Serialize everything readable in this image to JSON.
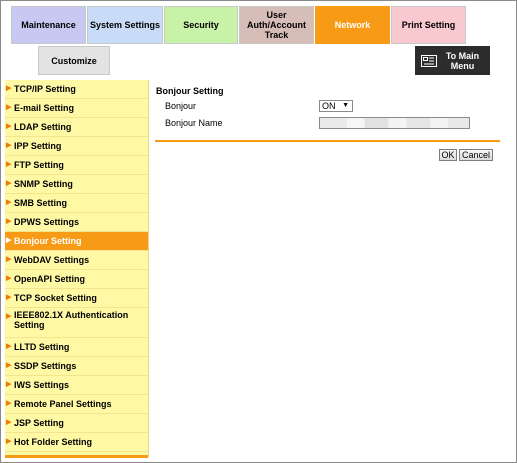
{
  "tabs": {
    "maintenance": "Maintenance",
    "system_settings": "System Settings",
    "security": "Security",
    "user_auth_line1": "User",
    "user_auth_line2": "Auth/Account",
    "user_auth_line3": "Track",
    "network": "Network",
    "print_setting": "Print Setting",
    "customize": "Customize"
  },
  "main_menu": {
    "line1": "To Main",
    "line2": "Menu",
    "icon": "main-menu-icon"
  },
  "sidebar": {
    "items": [
      "TCP/IP Setting",
      "E-mail Setting",
      "LDAP Setting",
      "IPP Setting",
      "FTP Setting",
      "SNMP Setting",
      "SMB Setting",
      "DPWS Settings",
      "Bonjour Setting",
      "WebDAV Settings",
      "OpenAPI Setting",
      "TCP Socket Setting",
      "IEEE802.1X Authentication Setting",
      "LLTD Setting",
      "SSDP Settings",
      "IWS Settings",
      "Remote Panel Settings",
      "JSP Setting",
      "Hot Folder Setting"
    ],
    "active": "Bonjour Setting"
  },
  "content": {
    "title": "Bonjour Setting",
    "bonjour_label": "Bonjour",
    "bonjour_value": "ON",
    "bonjour_name_label": "Bonjour Name",
    "bonjour_name_value": ""
  },
  "buttons": {
    "ok": "OK",
    "cancel": "Cancel"
  },
  "colors": {
    "accent": "#f79a15",
    "sidebar_bg": "#fff9a6"
  }
}
